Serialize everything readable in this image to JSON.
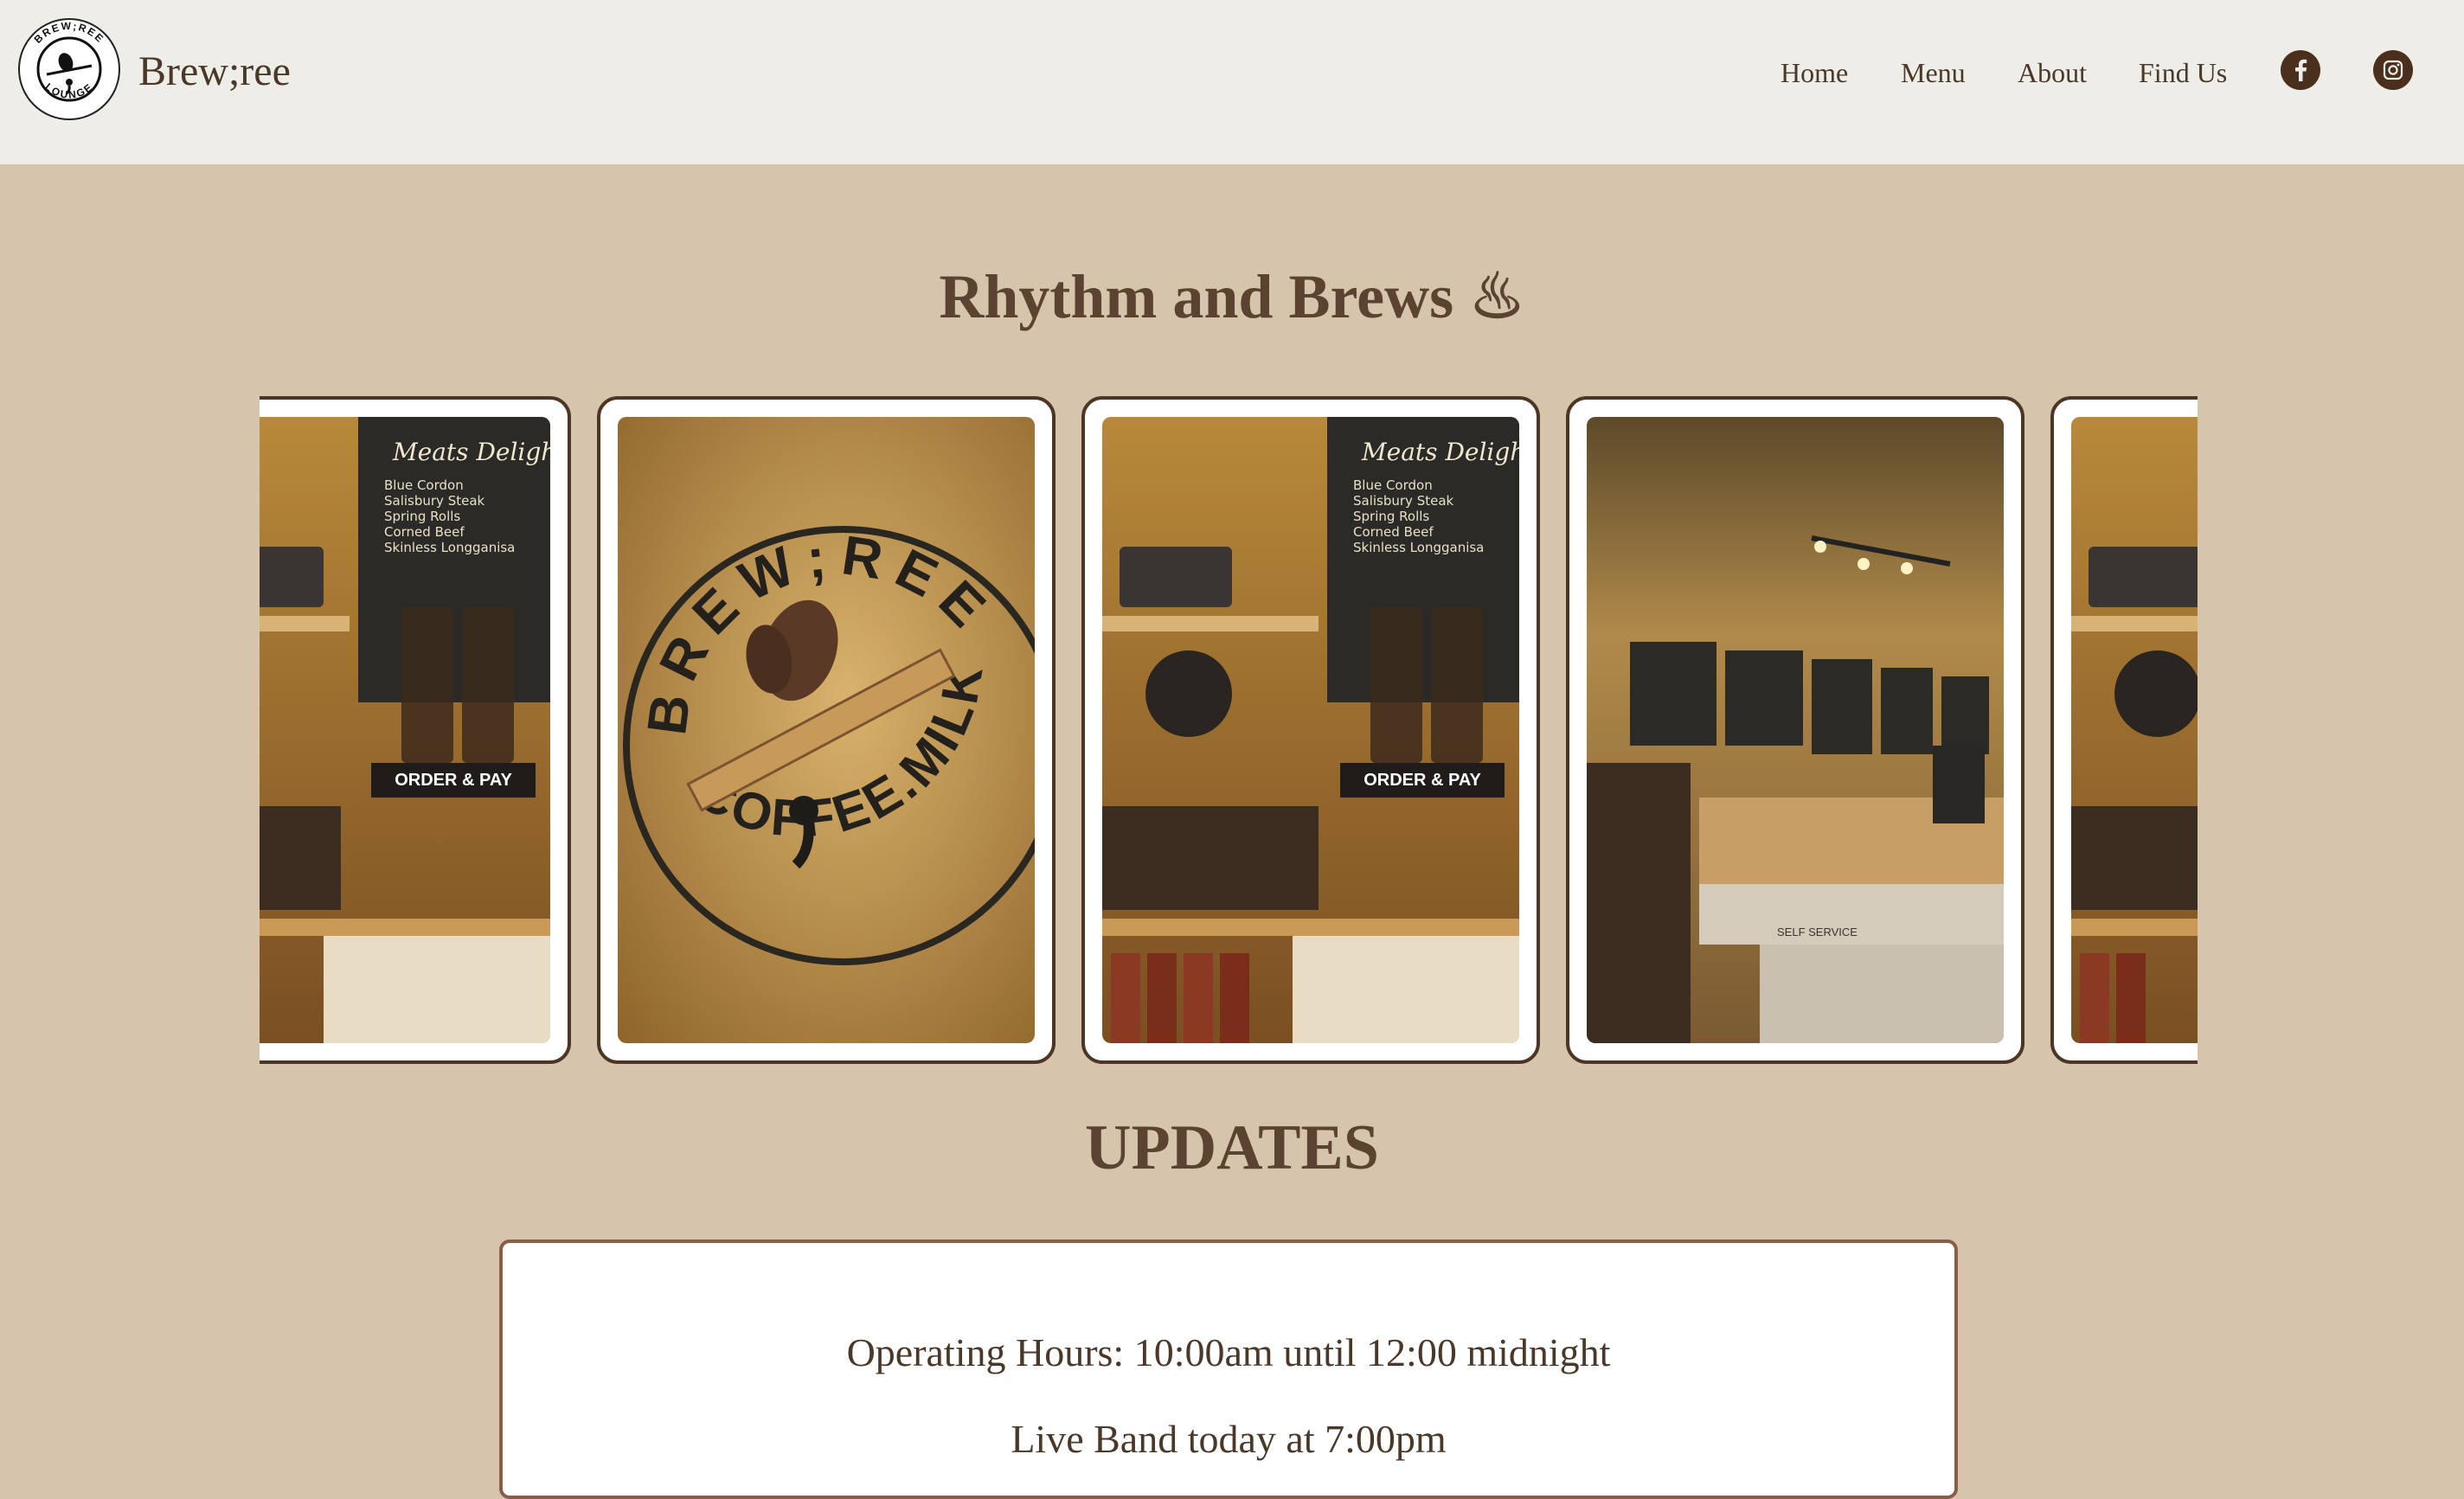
{
  "header": {
    "logo_text_top": "BREW;REE",
    "logo_text_bottom": "LOUNGE",
    "brand": "Brew;ree",
    "nav": [
      "Home",
      "Menu",
      "About",
      "Find Us"
    ],
    "social": [
      {
        "icon": "facebook-icon"
      },
      {
        "icon": "instagram-icon"
      }
    ]
  },
  "hero": {
    "title": "Rhythm and Brews ♨"
  },
  "gallery": {
    "photos": [
      {
        "scene": "counter",
        "sign": "ORDER & PAY",
        "board": "Meats Delight",
        "menu_items": [
          "Blue Cordon",
          "Salisbury Steak",
          "Spring Rolls",
          "Corned Beef",
          "Skinless Longganisa"
        ]
      },
      {
        "scene": "logo-wall",
        "wall_top": "BREW;REE",
        "wall_bottom": "ICED COFFEE.MILKTEA"
      },
      {
        "scene": "counter",
        "sign": "ORDER & PAY",
        "board": "Meats Delight",
        "menu_items": [
          "Blue Cordon",
          "Salisbury Steak",
          "Spring Rolls",
          "Corned Beef",
          "Skinless Longganisa"
        ]
      },
      {
        "scene": "wide",
        "counter_label": "SELF SERVICE"
      },
      {
        "scene": "counter-partial"
      }
    ]
  },
  "updates": {
    "title": "UPDATES",
    "items": [
      "Operating Hours: 10:00am until 12:00 midnight",
      "Live Band today at 7:00pm"
    ]
  },
  "colors": {
    "header_bg": "#efede8",
    "page_bg": "#d6c5ac",
    "text": "#5a4330",
    "card_border": "#4d3625",
    "accent_brown": "#4a2f1c"
  }
}
